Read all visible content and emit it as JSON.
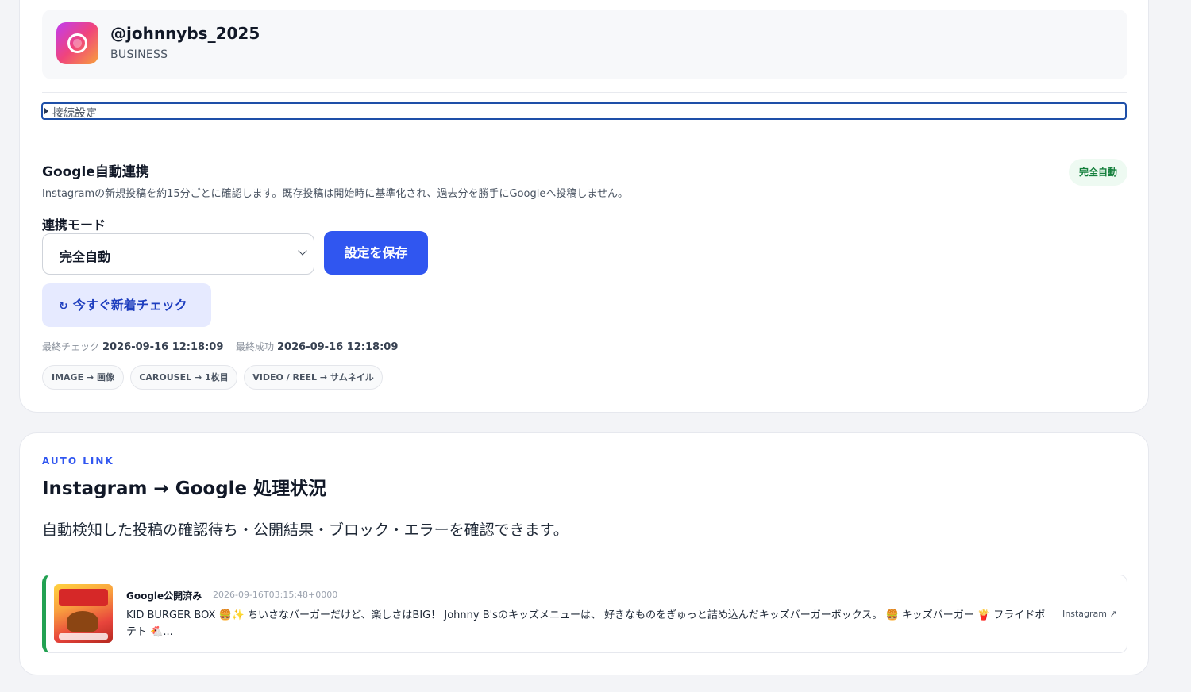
{
  "account": {
    "handle": "@johnnybs_2025",
    "type": "BUSINESS",
    "logo_icon": "instagram-icon"
  },
  "connection_settings": {
    "label": "接続設定"
  },
  "google_sync": {
    "title": "Google自動連携",
    "description": "Instagramの新規投稿を約15分ごとに確認します。既存投稿は開始時に基準化され、過去分を勝手にGoogleへ投稿しません。",
    "badge": "完全自動",
    "mode_label": "連携モード",
    "mode_value": "完全自動",
    "save_label": "設定を保存",
    "check_label": "今すぐ新着チェック",
    "check_icon": "↻",
    "last_check_label": "最終チェック",
    "last_check_value": "2026-09-16 12:18:09",
    "last_success_label": "最終成功",
    "last_success_value": "2026-09-16 12:18:09",
    "chips": [
      "IMAGE → 画像",
      "CAROUSEL → 1枚目",
      "VIDEO / REEL → サムネイル"
    ]
  },
  "status_section": {
    "eyebrow": "AUTO LINK",
    "title": "Instagram → Google 処理状況",
    "lead": "自動検知した投稿の確認待ち・公開結果・ブロック・エラーを確認できます。",
    "items": [
      {
        "status": "Google公開済み",
        "timestamp": "2026-09-16T03:15:48+0000",
        "text": "KID BURGER BOX 🍔✨ ちいさなバーガーだけど、楽しさはBIG！ Johnny B'sのキッズメニューは、 好きなものをぎゅっと詰め込んだキッズバーガーボックス。 🍔 キッズバーガー 🍟 フライドポテト 🐔...",
        "link_label": "Instagram ↗"
      }
    ]
  },
  "colors": {
    "primary": "#3056f0",
    "success": "#22a152",
    "badge_bg": "#eefaf2",
    "page_bg": "#f3f4f7"
  }
}
